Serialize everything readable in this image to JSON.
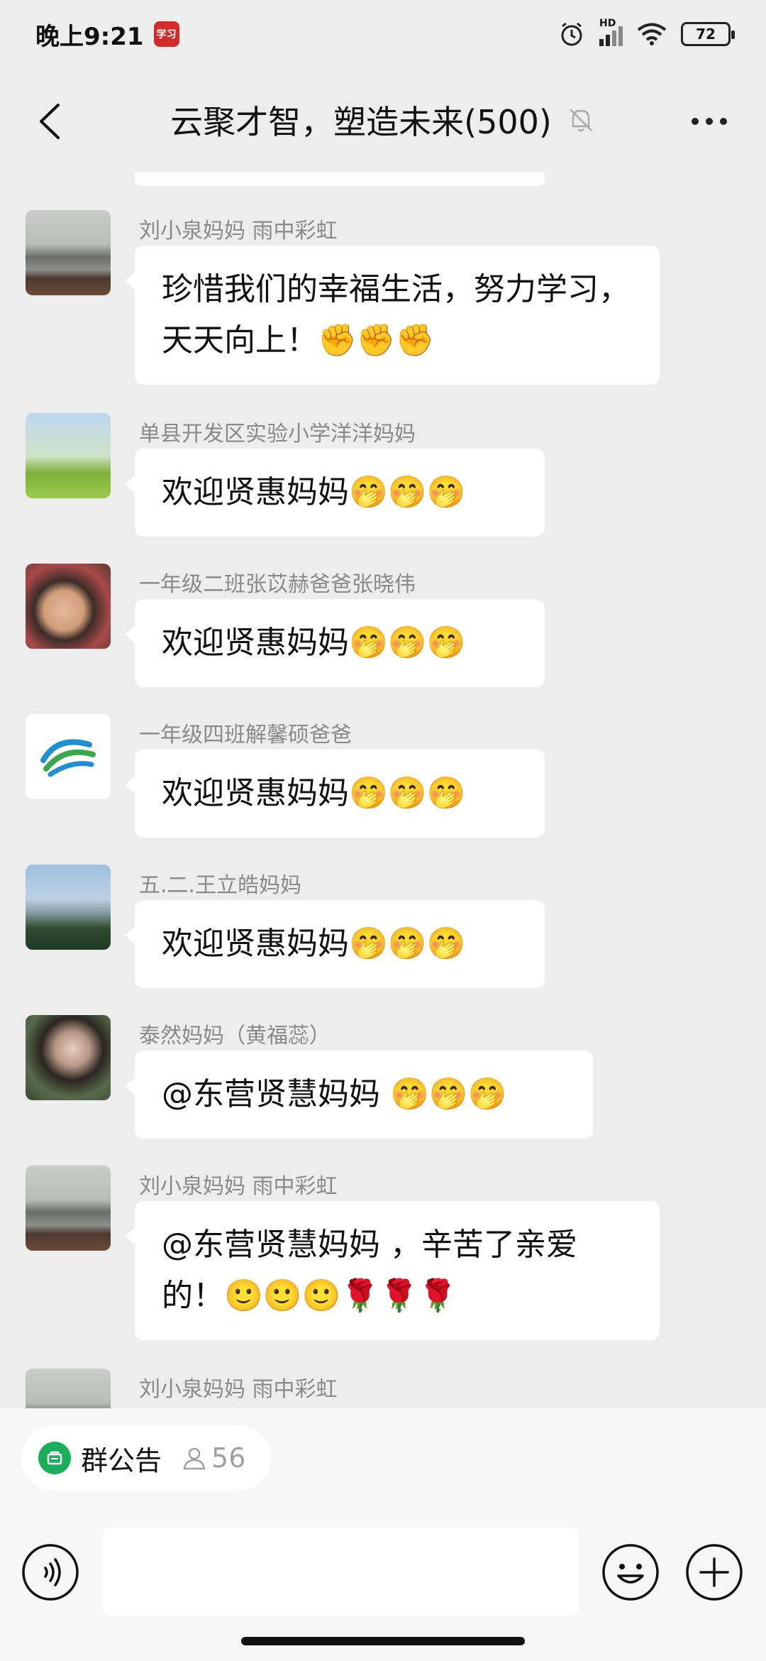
{
  "status_bar": {
    "time": "晚上9:21",
    "app_badge": "学习",
    "signal_label": "HD",
    "battery": "72"
  },
  "header": {
    "title": "云聚才智，塑造未来(500)"
  },
  "messages": [
    {
      "sender": "刘小泉妈妈  雨中彩虹",
      "text": "珍惜我们的幸福生活，努力学习，天天向上！✊✊✊"
    },
    {
      "sender": "单县开发区实验小学洋洋妈妈",
      "text": "欢迎贤惠妈妈🤭🤭🤭"
    },
    {
      "sender": "一年级二班张苡赫爸爸张晓伟",
      "text": "欢迎贤惠妈妈🤭🤭🤭"
    },
    {
      "sender": "一年级四班解馨硕爸爸",
      "text": "欢迎贤惠妈妈🤭🤭🤭"
    },
    {
      "sender": "五.二.王立皓妈妈",
      "text": "欢迎贤惠妈妈🤭🤭🤭"
    },
    {
      "sender": "泰然妈妈（黄福蕊）",
      "text": "@东营贤慧妈妈 🤭🤭🤭"
    },
    {
      "sender": "刘小泉妈妈  雨中彩虹",
      "text": "@东营贤慧妈妈 ，辛苦了亲爱的！🙂🙂🙂🌹🌹🌹"
    },
    {
      "sender": "刘小泉妈妈  雨中彩虹",
      "text": ""
    }
  ],
  "bottom": {
    "notice_label": "群公告",
    "member_count": "56",
    "input_placeholder": ""
  },
  "colors": {
    "background": "#ededed",
    "accent_green": "#1aad5a",
    "bubble": "#ffffff"
  }
}
